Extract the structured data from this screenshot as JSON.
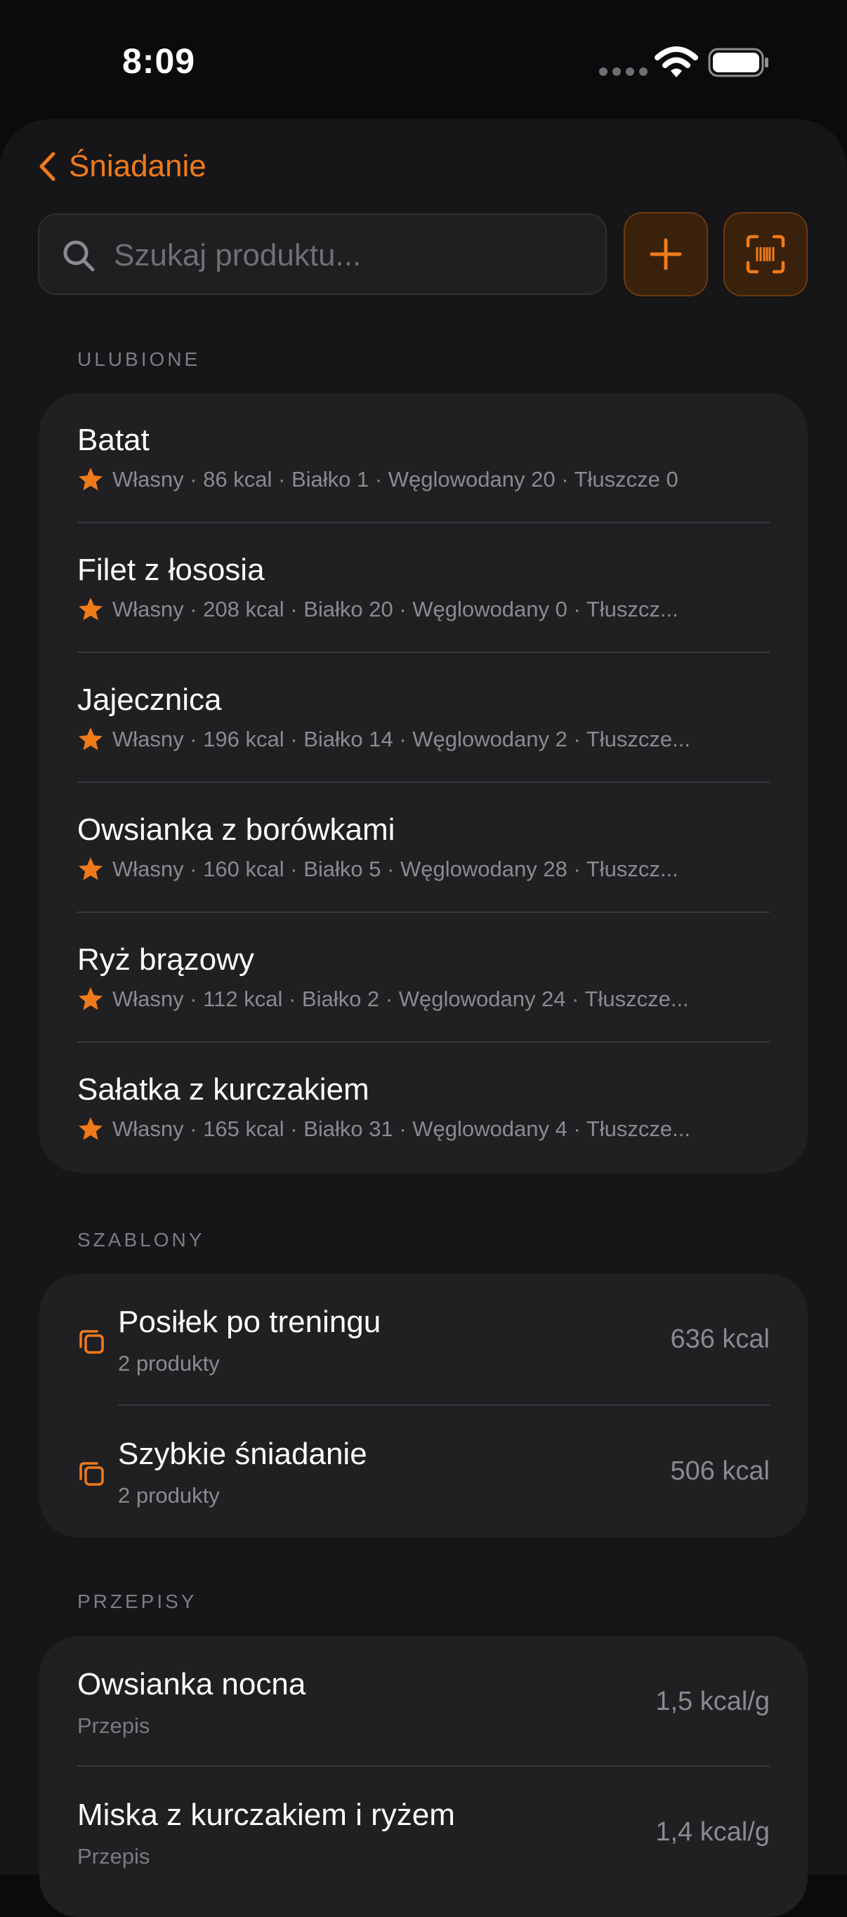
{
  "status_bar": {
    "time": "8:09"
  },
  "header": {
    "back_label": "Śniadanie"
  },
  "search": {
    "placeholder": "Szukaj produktu..."
  },
  "favorites": {
    "title": "ULUBIONE",
    "items": [
      {
        "name": "Batat",
        "detail": "Własny · 86 kcal · Białko 1 · Węglowodany 20 · Tłuszcze 0"
      },
      {
        "name": "Filet z łososia",
        "detail": "Własny · 208 kcal · Białko 20 · Węglowodany 0 · Tłuszcz..."
      },
      {
        "name": "Jajecznica",
        "detail": "Własny · 196 kcal · Białko 14 · Węglowodany 2 · Tłuszcze..."
      },
      {
        "name": "Owsianka z borówkami",
        "detail": "Własny · 160 kcal · Białko 5 · Węglowodany 28 · Tłuszcz..."
      },
      {
        "name": "Ryż brązowy",
        "detail": "Własny · 112 kcal · Białko 2 · Węglowodany 24 · Tłuszcze..."
      },
      {
        "name": "Sałatka z kurczakiem",
        "detail": "Własny · 165 kcal · Białko 31 · Węglowodany 4 · Tłuszcze..."
      }
    ]
  },
  "templates": {
    "title": "SZABLONY",
    "items": [
      {
        "name": "Posiłek po treningu",
        "sub": "2 produkty",
        "kcal": "636 kcal"
      },
      {
        "name": "Szybkie śniadanie",
        "sub": "2 produkty",
        "kcal": "506 kcal"
      }
    ]
  },
  "recipes": {
    "title": "PRZEPISY",
    "items": [
      {
        "name": "Owsianka nocna",
        "sub": "Przepis",
        "value": "1,5 kcal/g"
      },
      {
        "name": "Miska z kurczakiem i ryżem",
        "sub": "Przepis",
        "value": "1,4 kcal/g"
      }
    ]
  },
  "colors": {
    "accent": "#f07a1a",
    "background": "#0b0b0d",
    "card": "#202023"
  }
}
